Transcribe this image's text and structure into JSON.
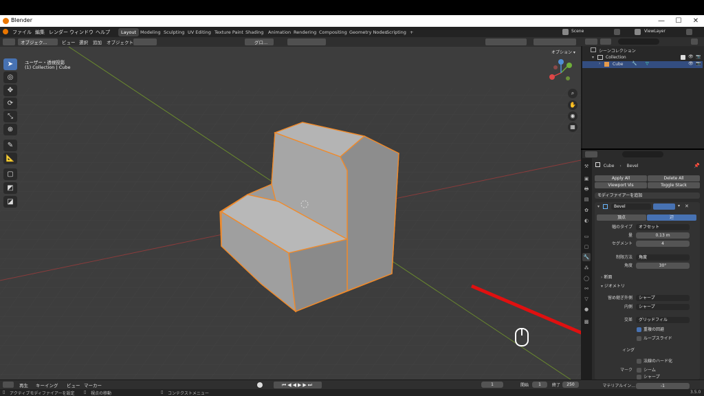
{
  "app": {
    "title": "Blender",
    "window_buttons": [
      "—",
      "☐",
      "✕"
    ]
  },
  "menubar": {
    "menus": [
      "ファイル",
      "編集",
      "レンダー",
      "ウィンドウ",
      "ヘルプ"
    ],
    "workspaces": [
      "Layout",
      "Modeling",
      "Sculpting",
      "UV Editing",
      "Texture Paint",
      "Shading",
      "Animation",
      "Rendering",
      "Compositing",
      "Geometry Nodes",
      "Scripting"
    ],
    "add_tab": "+",
    "scene_label": "Scene",
    "viewlayer_label": "ViewLayer"
  },
  "viewport_header": {
    "mode": "オブジェク...",
    "items": [
      "ビュー",
      "選択",
      "追加",
      "オブジェクト"
    ],
    "transform_orientation": "グロ...",
    "options": "オプション ▾"
  },
  "viewport": {
    "view_name": "ユーザー・透視投影",
    "collection_info": "(1) Collection | Cube"
  },
  "outliner": {
    "title": "シーンコレクション",
    "rows": [
      {
        "label": "Collection"
      },
      {
        "label": "Cube"
      }
    ]
  },
  "properties": {
    "breadcrumb_object": "Cube",
    "breadcrumb_modifier": "Bevel",
    "apply_all": "Apply All",
    "delete_all": "Delete All",
    "viewport_vis": "Viewport Vis",
    "toggle_stack": "Toggle Stack",
    "add_modifier": "モディファイアーを追加",
    "modifier_name": "Bevel",
    "affect_vertices": "頂点",
    "affect_edges": "辺",
    "width_type_label": "幅のタイプ",
    "width_type_value": "オフセット",
    "amount_label": "量",
    "amount_value": "0.13 m",
    "segments_label": "セグメント",
    "segments_value": "4",
    "limit_method_label": "制限方法",
    "limit_method_value": "角度",
    "angle_label": "角度",
    "angle_value": "30°",
    "profile_section": "断面",
    "geometry_section": "ジオメトリ",
    "miter_outer_label": "留め継ぎ外側",
    "miter_outer_value": "シャープ",
    "miter_inner_label": "内側",
    "miter_inner_value": "シャープ",
    "intersection_label": "交差",
    "intersection_value": "グリッドフィル",
    "clamp_overlap": "重複の回避",
    "loop_slide": "ループスライド",
    "shading_section": "ィング",
    "harden_normals": "法線のハード化",
    "mark_label": "マーク",
    "mark_seam": "シーム",
    "mark_sharp": "シャープ",
    "material_index_label": "マテリアルイン...",
    "material_index_value": "-1"
  },
  "timeline": {
    "playback": "再生",
    "keying": "キーイング",
    "view": "ビュー",
    "marker": "マーカー",
    "current_frame": "1",
    "start_label": "開始",
    "start_value": "1",
    "end_label": "終了",
    "end_value": "250"
  },
  "statusbar": {
    "hint1": "アクティブモディファイアーを設定",
    "hint2": "視点の移動",
    "hint3": "コンテクストメニュー",
    "version": "3.5.0"
  }
}
